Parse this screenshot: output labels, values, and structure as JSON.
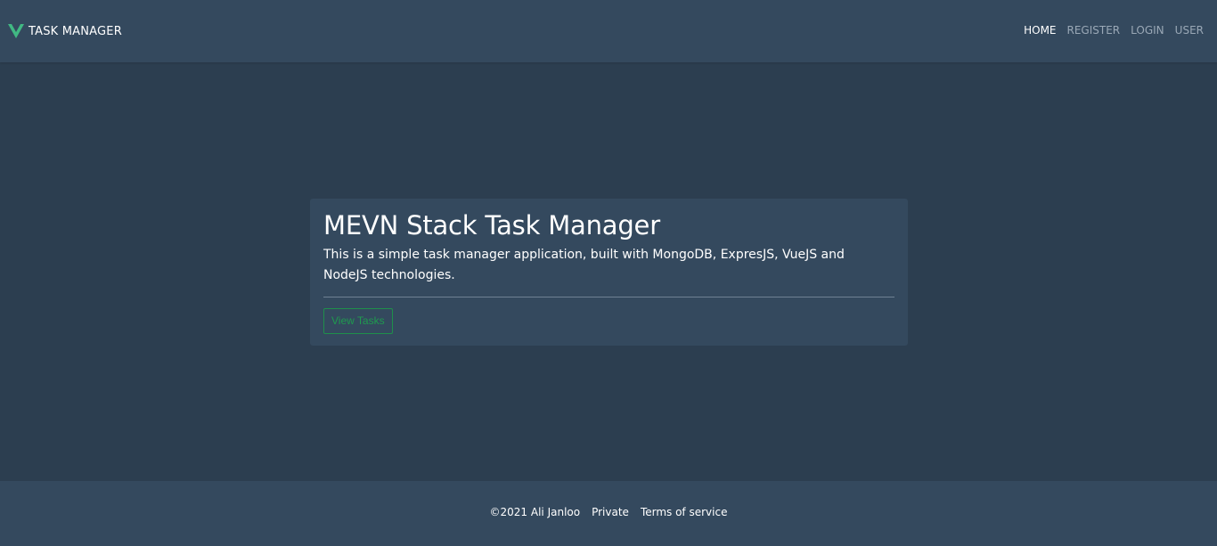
{
  "navbar": {
    "brand_text": "TASK MANAGER",
    "logo_icon": "vue-v-logo-icon",
    "brand_color": "#41b883",
    "links": [
      {
        "label": "HOME",
        "active": true
      },
      {
        "label": "REGISTER",
        "active": false
      },
      {
        "label": "LOGIN",
        "active": false
      },
      {
        "label": "USER",
        "active": false
      }
    ]
  },
  "hero": {
    "title": "MEVN Stack Task Manager",
    "description": "This is a simple task manager application, built with MongoDB, ExpresJS, VueJS and NodeJS technologies.",
    "button_label": "View Tasks"
  },
  "footer": {
    "copyright": "©2021 Ali Janloo",
    "links": [
      "Private",
      "Terms of service"
    ]
  },
  "colors": {
    "page_bg": "#2c3e50",
    "panel_bg": "#34495e",
    "success_outline": "#1f9a4f"
  }
}
